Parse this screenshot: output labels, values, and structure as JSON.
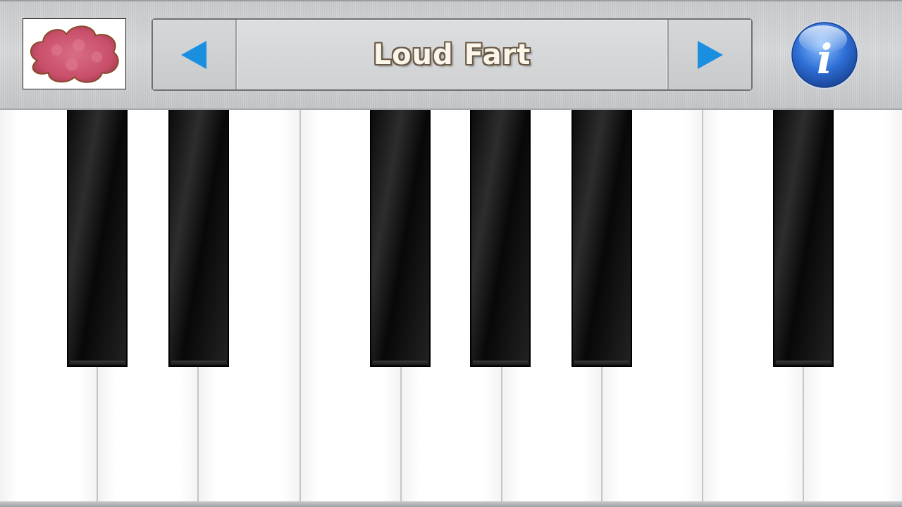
{
  "toolbar": {
    "sound_name": "Loud Fart",
    "thumbnail_icon": "fart-cloud-icon",
    "prev_icon": "arrow-left-icon",
    "next_icon": "arrow-right-icon",
    "info_icon": "info-icon",
    "colors": {
      "arrow": "#1a8fe0",
      "cloud": "#c94f6b",
      "info_blue": "#2e6fd6",
      "title_fill": "#fbf6ea",
      "title_outline": "#6b5a48"
    }
  },
  "keyboard": {
    "white_keys": [
      "C",
      "D",
      "E",
      "F",
      "G",
      "A",
      "B",
      "C2",
      "D2"
    ],
    "black_keys": [
      "C#",
      "D#",
      "F#",
      "G#",
      "A#",
      "C#2"
    ]
  }
}
